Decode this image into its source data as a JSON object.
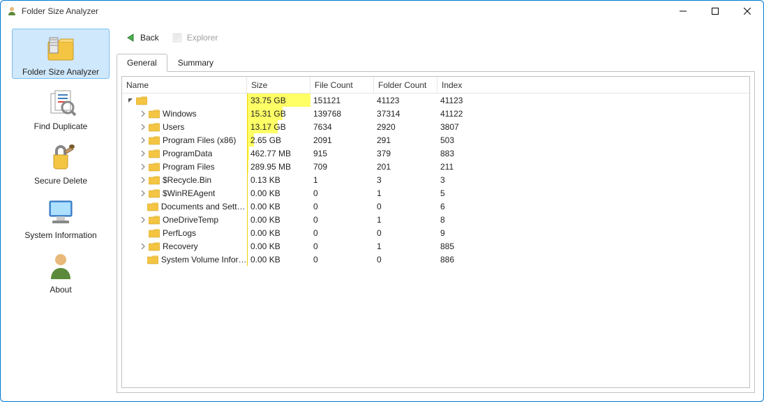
{
  "window": {
    "title": "Folder Size Analyzer"
  },
  "title_controls": {
    "min": "—",
    "max": "☐",
    "close": "✕"
  },
  "sidebar": {
    "items": [
      {
        "id": "analyzer",
        "label": "Folder Size Analyzer",
        "selected": true
      },
      {
        "id": "dup",
        "label": "Find Duplicate",
        "selected": false
      },
      {
        "id": "secdel",
        "label": "Secure Delete",
        "selected": false
      },
      {
        "id": "sysinfo",
        "label": "System Information",
        "selected": false
      },
      {
        "id": "about",
        "label": "About",
        "selected": false
      }
    ]
  },
  "toolbar": {
    "back": {
      "label": "Back"
    },
    "explorer": {
      "label": "Explorer"
    }
  },
  "tabs": [
    {
      "id": "general",
      "label": "General",
      "active": true
    },
    {
      "id": "summary",
      "label": "Summary",
      "active": false
    }
  ],
  "grid": {
    "headers": {
      "name": "Name",
      "size": "Size",
      "file": "File Count",
      "folder": "Folder Count",
      "index": "Index"
    },
    "rows": [
      {
        "indent": 0,
        "expanded": true,
        "has_children": true,
        "name": "",
        "size": "33.75 GB",
        "hl_pct": 100,
        "file": "151121",
        "folder": "41123",
        "index": "41123"
      },
      {
        "indent": 1,
        "expanded": false,
        "has_children": true,
        "name": "Windows",
        "size": "15.31 GB",
        "hl_pct": 56,
        "file": "139768",
        "folder": "37314",
        "index": "41122"
      },
      {
        "indent": 1,
        "expanded": false,
        "has_children": true,
        "name": "Users",
        "size": "13.17 GB",
        "hl_pct": 48,
        "file": "7634",
        "folder": "2920",
        "index": "3807"
      },
      {
        "indent": 1,
        "expanded": false,
        "has_children": true,
        "name": "Program Files (x86)",
        "size": "2.65 GB",
        "hl_pct": 10,
        "file": "2091",
        "folder": "291",
        "index": "503"
      },
      {
        "indent": 1,
        "expanded": false,
        "has_children": true,
        "name": "ProgramData",
        "size": "462.77 MB",
        "hl_pct": 2,
        "file": "915",
        "folder": "379",
        "index": "883"
      },
      {
        "indent": 1,
        "expanded": false,
        "has_children": true,
        "name": "Program Files",
        "size": "289.95 MB",
        "hl_pct": 1,
        "file": "709",
        "folder": "201",
        "index": "211"
      },
      {
        "indent": 1,
        "expanded": false,
        "has_children": true,
        "name": "$Recycle.Bin",
        "size": "0.13 KB",
        "hl_pct": 0,
        "file": "1",
        "folder": "3",
        "index": "3"
      },
      {
        "indent": 1,
        "expanded": false,
        "has_children": true,
        "name": "$WinREAgent",
        "size": "0.00 KB",
        "hl_pct": 0,
        "file": "0",
        "folder": "1",
        "index": "5"
      },
      {
        "indent": 1,
        "expanded": false,
        "has_children": false,
        "name": "Documents and Settings",
        "size": "0.00 KB",
        "hl_pct": 0,
        "file": "0",
        "folder": "0",
        "index": "6"
      },
      {
        "indent": 1,
        "expanded": false,
        "has_children": true,
        "name": "OneDriveTemp",
        "size": "0.00 KB",
        "hl_pct": 0,
        "file": "0",
        "folder": "1",
        "index": "8"
      },
      {
        "indent": 1,
        "expanded": false,
        "has_children": false,
        "name": "PerfLogs",
        "size": "0.00 KB",
        "hl_pct": 0,
        "file": "0",
        "folder": "0",
        "index": "9"
      },
      {
        "indent": 1,
        "expanded": false,
        "has_children": true,
        "name": "Recovery",
        "size": "0.00 KB",
        "hl_pct": 0,
        "file": "0",
        "folder": "1",
        "index": "885"
      },
      {
        "indent": 1,
        "expanded": false,
        "has_children": false,
        "name": "System Volume Inform...",
        "size": "0.00 KB",
        "hl_pct": 0,
        "file": "0",
        "folder": "0",
        "index": "886"
      }
    ]
  }
}
